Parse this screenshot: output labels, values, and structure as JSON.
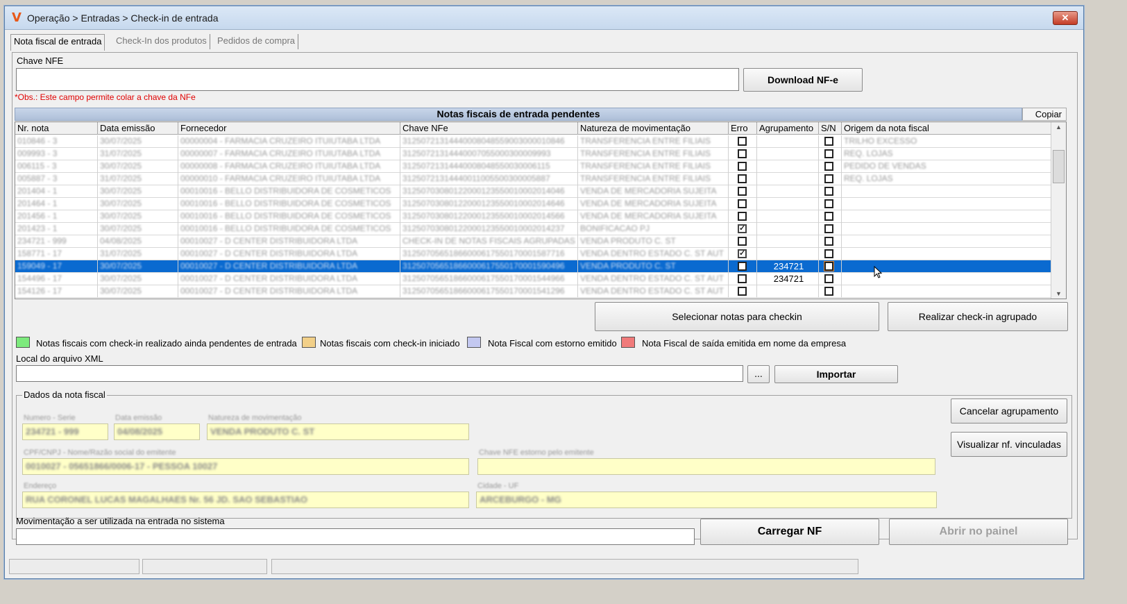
{
  "window": {
    "title": "Operação > Entradas > Check-in de entrada",
    "close_label": "✕"
  },
  "tabs": [
    {
      "label": "Nota fiscal de entrada"
    },
    {
      "label": "Check-In dos produtos"
    },
    {
      "label": "Pedidos de compra"
    }
  ],
  "nfe": {
    "label": "Chave NFE",
    "value": "",
    "download_label": "Download NF-e",
    "obs": "*Obs.: Este campo permite colar a chave da NFe"
  },
  "grid": {
    "title": "Notas fiscais de entrada pendentes",
    "copy_label": "Copiar",
    "columns": [
      "Nr. nota",
      "Data emissão",
      "Fornecedor",
      "Chave NFe",
      "Natureza de movimentação",
      "Erro",
      "Agrupamento",
      "S/N",
      "Origem da nota fiscal"
    ],
    "rows": [
      {
        "nr": "010846 - 3",
        "data": "30/07/2025",
        "forn": "00000004 - FARMACIA CRUZEIRO ITUIUTABA LTDA",
        "chave": "31250721314440008048559003000010846",
        "nat": "TRANSFERENCIA ENTRE FILIAIS",
        "erro": false,
        "agr": "",
        "sn": false,
        "origem": "TRILHO EXCESSO"
      },
      {
        "nr": "009993 - 3",
        "data": "31/07/2025",
        "forn": "00000007 - FARMACIA CRUZEIRO ITUIUTABA LTDA",
        "chave": "31250721314440007055000300009993",
        "nat": "TRANSFERENCIA ENTRE FILIAIS",
        "erro": false,
        "agr": "",
        "sn": false,
        "origem": "REQ. LOJAS"
      },
      {
        "nr": "006115 - 3",
        "data": "30/07/2025",
        "forn": "00000008 - FARMACIA CRUZEIRO ITUIUTABA LTDA",
        "chave": "31250721314440008048550030006115",
        "nat": "TRANSFERENCIA ENTRE FILIAIS",
        "erro": false,
        "agr": "",
        "sn": false,
        "origem": "PEDIDO DE VENDAS"
      },
      {
        "nr": "005887 - 3",
        "data": "31/07/2025",
        "forn": "00000010 - FARMACIA CRUZEIRO ITUIUTABA LTDA",
        "chave": "31250721314440011005500300005887",
        "nat": "TRANSFERENCIA ENTRE FILIAIS",
        "erro": false,
        "agr": "",
        "sn": false,
        "origem": "REQ. LOJAS"
      },
      {
        "nr": "201404 - 1",
        "data": "30/07/2025",
        "forn": "00010016 - BELLO DISTRIBUIDORA DE COSMETICOS",
        "chave": "31250703080122000123550010002014046",
        "nat": "VENDA DE MERCADORIA SUJEITA",
        "erro": false,
        "agr": "",
        "sn": false,
        "origem": ""
      },
      {
        "nr": "201464 - 1",
        "data": "30/07/2025",
        "forn": "00010016 - BELLO DISTRIBUIDORA DE COSMETICOS",
        "chave": "31250703080122000123550010002014646",
        "nat": "VENDA DE MERCADORIA SUJEITA",
        "erro": false,
        "agr": "",
        "sn": false,
        "origem": ""
      },
      {
        "nr": "201456 - 1",
        "data": "30/07/2025",
        "forn": "00010016 - BELLO DISTRIBUIDORA DE COSMETICOS",
        "chave": "31250703080122000123550010002014566",
        "nat": "VENDA DE MERCADORIA SUJEITA",
        "erro": false,
        "agr": "",
        "sn": false,
        "origem": ""
      },
      {
        "nr": "201423 - 1",
        "data": "30/07/2025",
        "forn": "00010016 - BELLO DISTRIBUIDORA DE COSMETICOS",
        "chave": "31250703080122000123550010002014237",
        "nat": "BONIFICACAO PJ",
        "erro": true,
        "agr": "",
        "sn": false,
        "origem": ""
      },
      {
        "nr": "234721 - 999",
        "data": "04/08/2025",
        "forn": "00010027 - D CENTER DISTRIBUIDORA LTDA",
        "chave": "CHECK-IN DE NOTAS FISCAIS AGRUPADAS",
        "nat": "VENDA PRODUTO C. ST",
        "erro": false,
        "agr": "",
        "sn": false,
        "origem": ""
      },
      {
        "nr": "158771 - 17",
        "data": "31/07/2025",
        "forn": "00010027 - D CENTER DISTRIBUIDORA LTDA",
        "chave": "31250705651866000617550170001587716",
        "nat": "VENDA DENTRO ESTADO C. ST AUT",
        "erro": true,
        "agr": "",
        "sn": false,
        "origem": ""
      },
      {
        "nr": "159049 - 17",
        "data": "30/07/2025",
        "forn": "00010027 - D CENTER DISTRIBUIDORA LTDA",
        "chave": "31250705651866000617550170001590496",
        "nat": "VENDA PRODUTO C. ST",
        "erro": false,
        "agr": "234721",
        "sn": false,
        "origem": "",
        "selected": true
      },
      {
        "nr": "154496 - 17",
        "data": "30/07/2025",
        "forn": "00010027 - D CENTER DISTRIBUIDORA LTDA",
        "chave": "31250705651866000617550170001544966",
        "nat": "VENDA DENTRO ESTADO C. ST AUT",
        "erro": false,
        "agr": "234721",
        "sn": false,
        "origem": ""
      },
      {
        "nr": "154126 - 17",
        "data": "30/07/2025",
        "forn": "00010027 - D CENTER DISTRIBUIDORA LTDA",
        "chave": "31250705651866000617550170001541296",
        "nat": "VENDA DENTRO ESTADO C. ST AUT",
        "erro": false,
        "agr": "",
        "sn": false,
        "origem": ""
      }
    ]
  },
  "actions": {
    "select_label": "Selecionar notas para checkin",
    "group_label": "Realizar check-in agrupado"
  },
  "legend": [
    {
      "color": "#7dea7d",
      "label": "Notas fiscais com check-in realizado ainda pendentes de entrada"
    },
    {
      "color": "#f2d089",
      "label": "Notas fiscais com check-in iniciado"
    },
    {
      "color": "#c3c8f0",
      "label": "Nota Fiscal com estorno emitido"
    },
    {
      "color": "#f07a7a",
      "label": "Nota Fiscal de saída emitida em nome da empresa"
    }
  ],
  "xml": {
    "label": "Local do arquivo XML",
    "value": "",
    "browse_label": "...",
    "import_label": "Importar"
  },
  "dados": {
    "title": "Dados da nota fiscal",
    "numero_label": "Numero - Serie",
    "numero": "234721 - 999",
    "data_label": "Data emissão",
    "data": "04/08/2025",
    "natureza_label": "Natureza de movimentação",
    "natureza": "VENDA PRODUTO C. ST",
    "emitente_label": "CPF/CNPJ - Nome/Razão social do emitente",
    "emitente": "0010027 - 05651866/0006-17 - PESSOA 10027",
    "estorno_label": "Chave NFE estorno pelo emitente",
    "estorno": "",
    "endereco_label": "Endereço",
    "endereco": "RUA CORONEL LUCAS MAGALHAES Nr. 56 JD. SAO SEBASTIAO",
    "cidade_label": "Cidade - UF",
    "cidade": "ARCEBURGO - MG",
    "cancel_label": "Cancelar agrupamento",
    "vinculadas_label": "Visualizar nf. vinculadas"
  },
  "mov": {
    "label": "Movimentação a ser utilizada na entrada no sistema",
    "value": "",
    "carregar_label": "Carregar NF",
    "abrir_label": "Abrir no painel"
  }
}
